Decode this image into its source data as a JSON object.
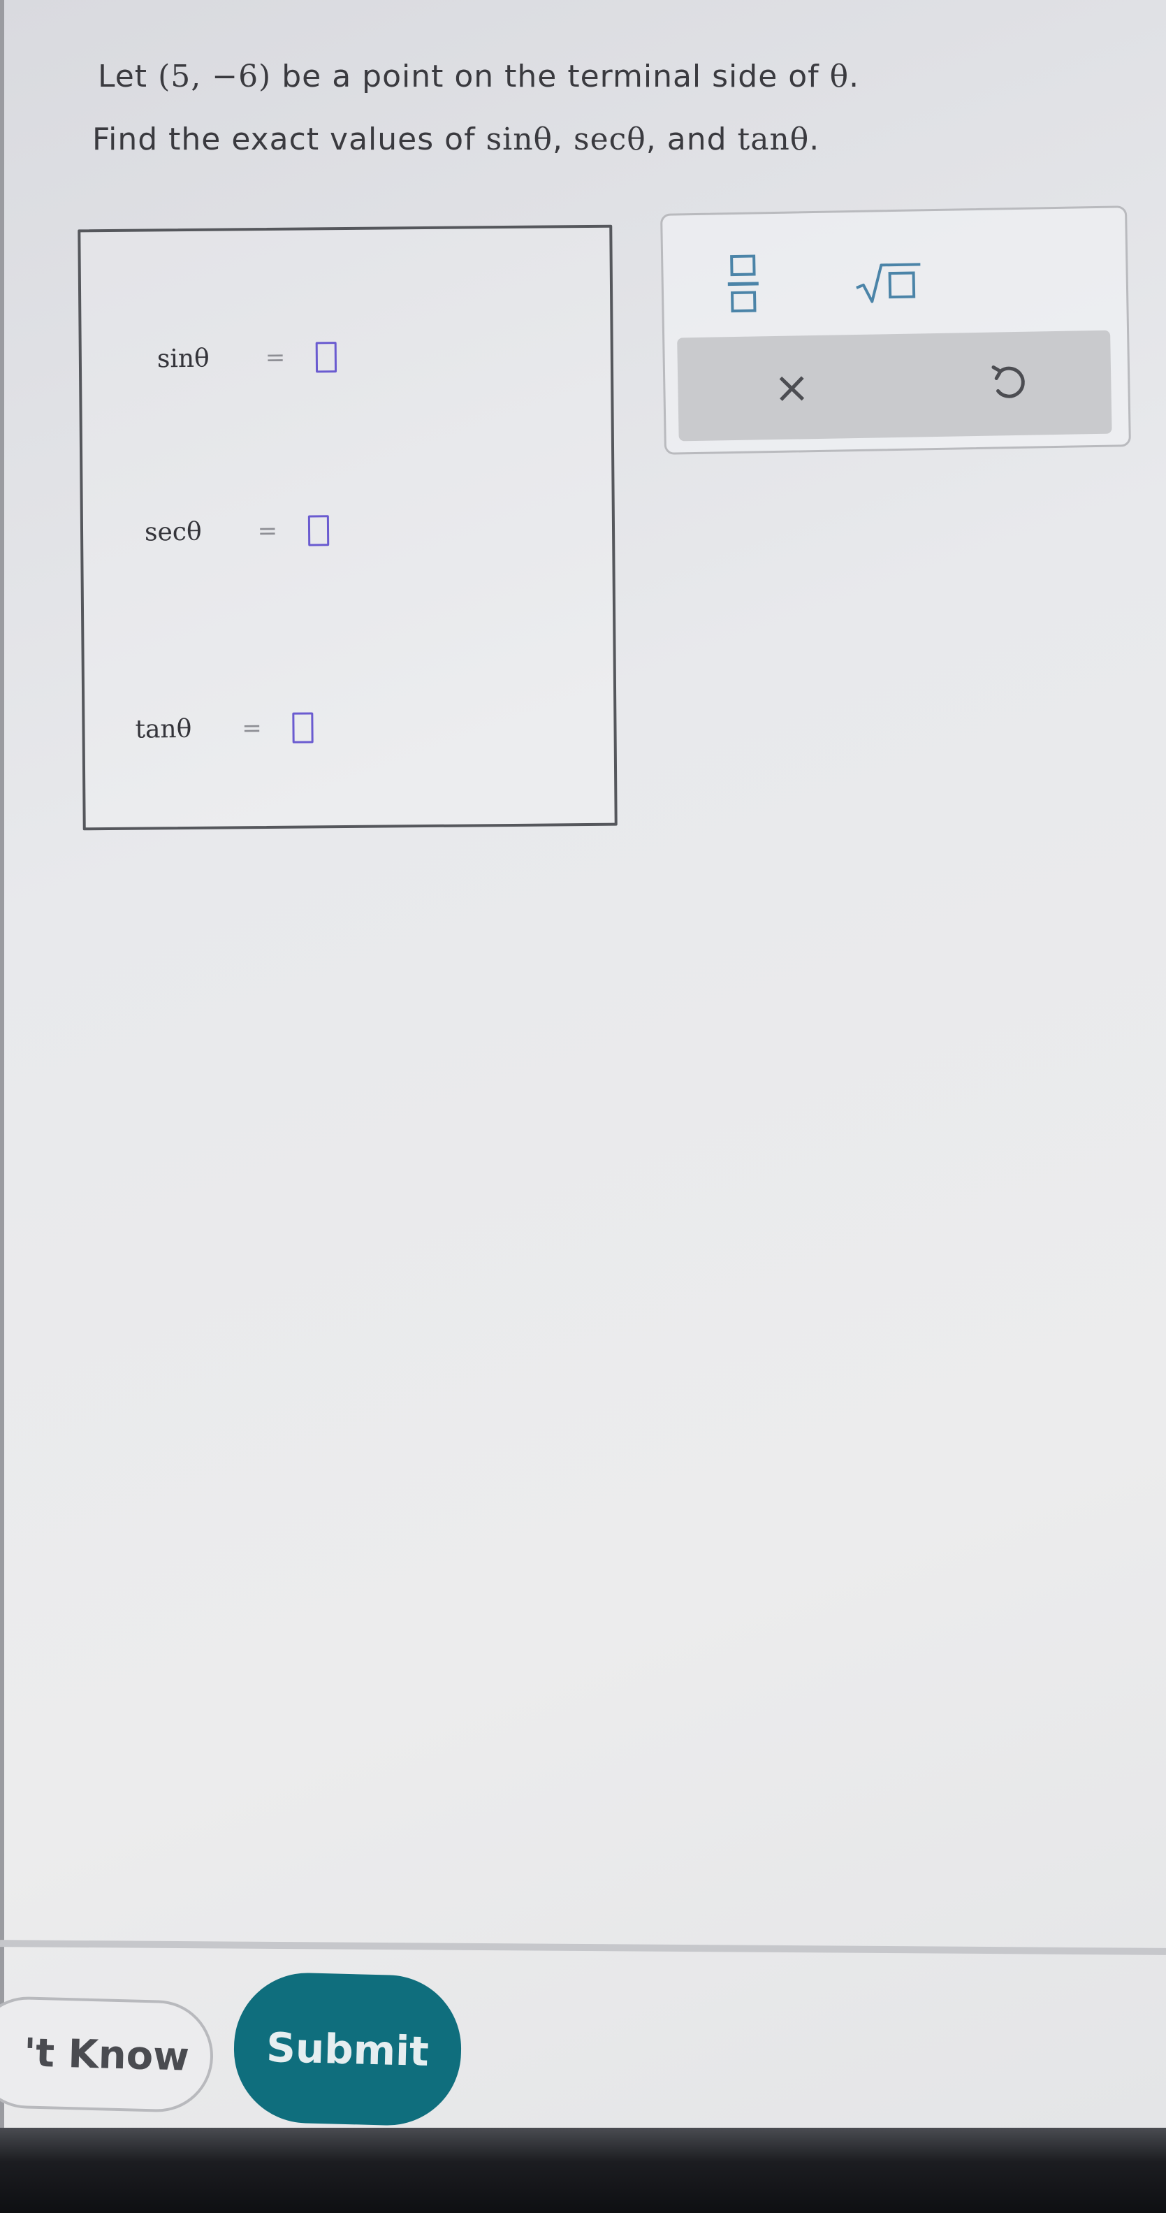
{
  "question": {
    "line1_prefix": "Let ",
    "point": "(5, −6)",
    "line1_mid": " be a point on the terminal side of ",
    "theta": "θ",
    "line1_end": ".",
    "line2_prefix": "Find the exact values of ",
    "sin": "sinθ",
    "sep1": ", ",
    "sec": "secθ",
    "sep2": ", and ",
    "tan": "tanθ",
    "line2_end": "."
  },
  "answers": [
    {
      "label": "sinθ",
      "equals": "="
    },
    {
      "label": "secθ",
      "equals": "="
    },
    {
      "label": "tanθ",
      "equals": "="
    }
  ],
  "toolbar": {
    "fraction_icon": "fraction-icon",
    "sqrt_icon": "square-root-icon",
    "clear_label": "×",
    "undo_icon": "undo-icon"
  },
  "footer": {
    "dont_know_label": "'t Know",
    "submit_label": "Submit"
  },
  "colors": {
    "answer_blank": "#6a5bd0",
    "tool_icon": "#4b84a8",
    "submit_bg": "#0f6e7d"
  }
}
